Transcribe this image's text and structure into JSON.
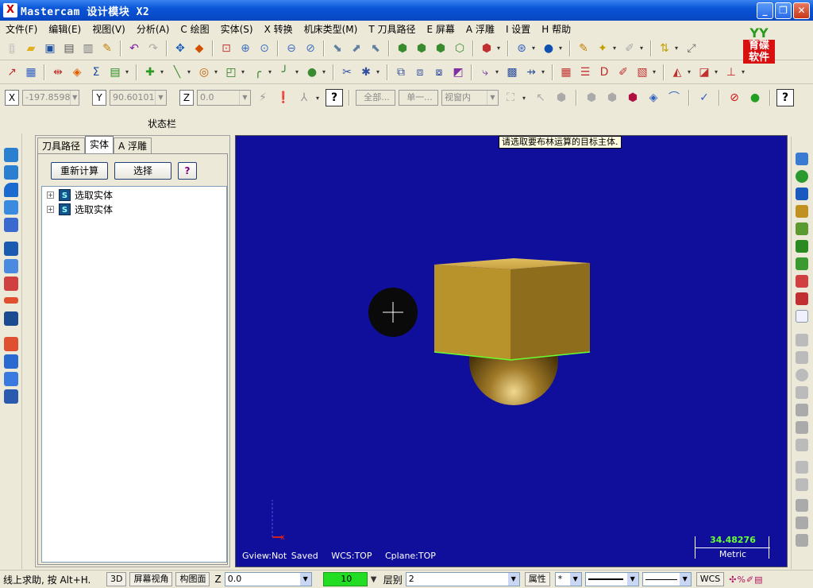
{
  "window": {
    "title": "Mastercam 设计模块  X2",
    "app_icon": "X",
    "controls": [
      "_",
      "❐",
      "✕"
    ]
  },
  "menu": [
    "文件(F)",
    "编辑(E)",
    "视图(V)",
    "分析(A)",
    "C 绘图",
    "实体(S)",
    "X 转换",
    "机床类型(M)",
    "T 刀具路径",
    "E 屏幕",
    "A 浮雕",
    "I 设置",
    "H 帮助"
  ],
  "logo": {
    "top": "YY",
    "bottom1": "育碟",
    "bottom2": "软件"
  },
  "coords": {
    "x_label": "X",
    "x_value": "-197.8598",
    "y_label": "Y",
    "y_value": "90.60101",
    "z_label": "Z",
    "z_value": "0.0",
    "all_label": "全部...",
    "single_label": "单一...",
    "view_label": "视窗内"
  },
  "status_label": "状态栏",
  "panel": {
    "tabs": [
      "刀具路径",
      "实体",
      "A 浮雕"
    ],
    "recalc_button": "重新计算",
    "select_button": "选择",
    "help_button": "?",
    "tree": [
      {
        "expander": "+",
        "icon": "S",
        "label": "选取实体"
      },
      {
        "expander": "+",
        "icon": "S",
        "label": "选取实体"
      }
    ]
  },
  "viewport": {
    "tooltip": "请选取要布林运算的目标主体.",
    "gview": "Gview:Not Saved",
    "wcs": "WCS:TOP",
    "cplane": "Cplane:TOP",
    "scale_value": "34.48276",
    "scale_unit": "Metric",
    "bg_color": "#0f0f9c",
    "box_color": "#b8922a",
    "sphere_color": "#8a6a20"
  },
  "bottom": {
    "hint": "线上求助, 按 Alt+H.",
    "btn_3d": "3D",
    "btn_screen_view": "屏幕视角",
    "btn_construct": "构图面",
    "z_label": "Z",
    "z_value": "0.0",
    "color_value": "10",
    "layer_label": "层别",
    "layer_value": "2",
    "attr_label": "属性",
    "point_style": "*",
    "wcs_button": "WCS"
  }
}
